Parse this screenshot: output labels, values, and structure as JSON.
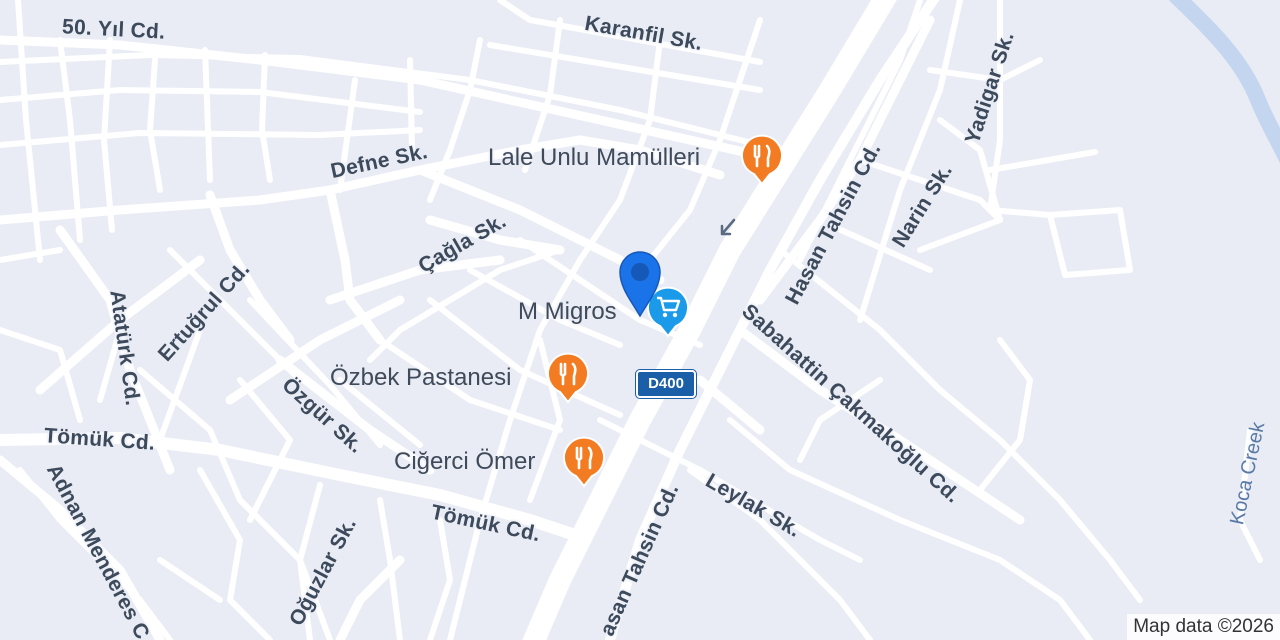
{
  "map": {
    "streets": [
      {
        "id": "50-yil-cd",
        "text": "50. Yıl Cd."
      },
      {
        "id": "karanfil-sk",
        "text": "Karanfil Sk."
      },
      {
        "id": "defne-sk",
        "text": "Defne Sk."
      },
      {
        "id": "yadigar-sk",
        "text": "Yadigar Sk."
      },
      {
        "id": "hasan-tahsin-cd-north",
        "text": "Hasan Tahsin Cd."
      },
      {
        "id": "narin-sk",
        "text": "Narin Sk."
      },
      {
        "id": "cagla-sk",
        "text": "Çağla Sk."
      },
      {
        "id": "ertugrul-cd",
        "text": "Ertuğrul Cd."
      },
      {
        "id": "ataturk-cd",
        "text": "Atatürk Cd."
      },
      {
        "id": "ozgur-sk",
        "text": "Özgür Sk."
      },
      {
        "id": "tomuk-cd-west",
        "text": "Tömük Cd."
      },
      {
        "id": "tomuk-cd-east",
        "text": "Tömük Cd."
      },
      {
        "id": "sabahattin-cakmakoglu-cd",
        "text": "Sabahattin Çakmakoğlu Cd."
      },
      {
        "id": "leylak-sk",
        "text": "Leylak Sk."
      },
      {
        "id": "hasan-tahsin-cd-south",
        "text": "asan Tahsin Cd."
      },
      {
        "id": "oguzlar-sk",
        "text": "Oğuzlar Sk."
      },
      {
        "id": "adnan-menderes",
        "text": "Adnan Menderes C"
      }
    ],
    "water": [
      {
        "id": "koca-creek",
        "text": "Koca Creek"
      }
    ],
    "pois": [
      {
        "id": "lale-unlu-mamulleri",
        "text": "Lale Unlu Mamülleri",
        "icon": "restaurant-icon",
        "color": "#f37c22"
      },
      {
        "id": "m-migros",
        "text": "M Migros",
        "icon": "shopping-cart-icon",
        "color": "#1a9ae8"
      },
      {
        "id": "ozbek-pastanesi",
        "text": "Özbek Pastanesi",
        "icon": "restaurant-icon",
        "color": "#f37c22"
      },
      {
        "id": "cigerci-omer",
        "text": "Ciğerci Ömer",
        "icon": "restaurant-icon",
        "color": "#f37c22"
      }
    ],
    "route_shield": "D400",
    "selected_marker": {
      "icon": "location-pin-icon",
      "color": "#1a73e8"
    },
    "attribution": "Map data ©2026",
    "colors": {
      "background": "#e9ecf4",
      "road": "#ffffff",
      "water": "#c4d6ef",
      "label": "#3c4a5c"
    }
  }
}
